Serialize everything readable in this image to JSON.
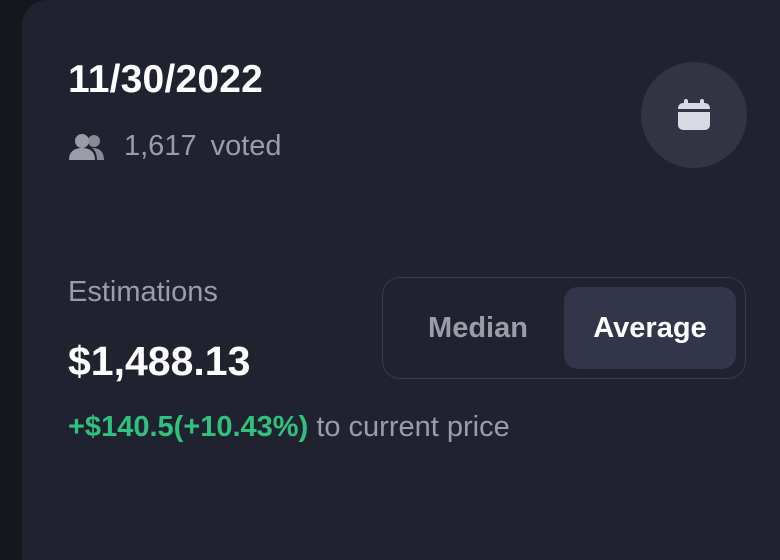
{
  "header": {
    "date": "11/30/2022",
    "voted_count": "1,617",
    "voted_label": "voted"
  },
  "estimations": {
    "label": "Estimations",
    "value": "$1,488.13",
    "delta": "+$140.5(+10.43%)",
    "delta_suffix": "to current price"
  },
  "toggle": {
    "options": [
      "Median",
      "Average"
    ],
    "selected": "Average"
  },
  "icons": {
    "voters": "users-icon",
    "calendar": "calendar-icon"
  },
  "colors": {
    "background": "#212230",
    "positive": "#2ec27e",
    "muted": "#9a9ca8",
    "active_bg": "#33354a"
  }
}
